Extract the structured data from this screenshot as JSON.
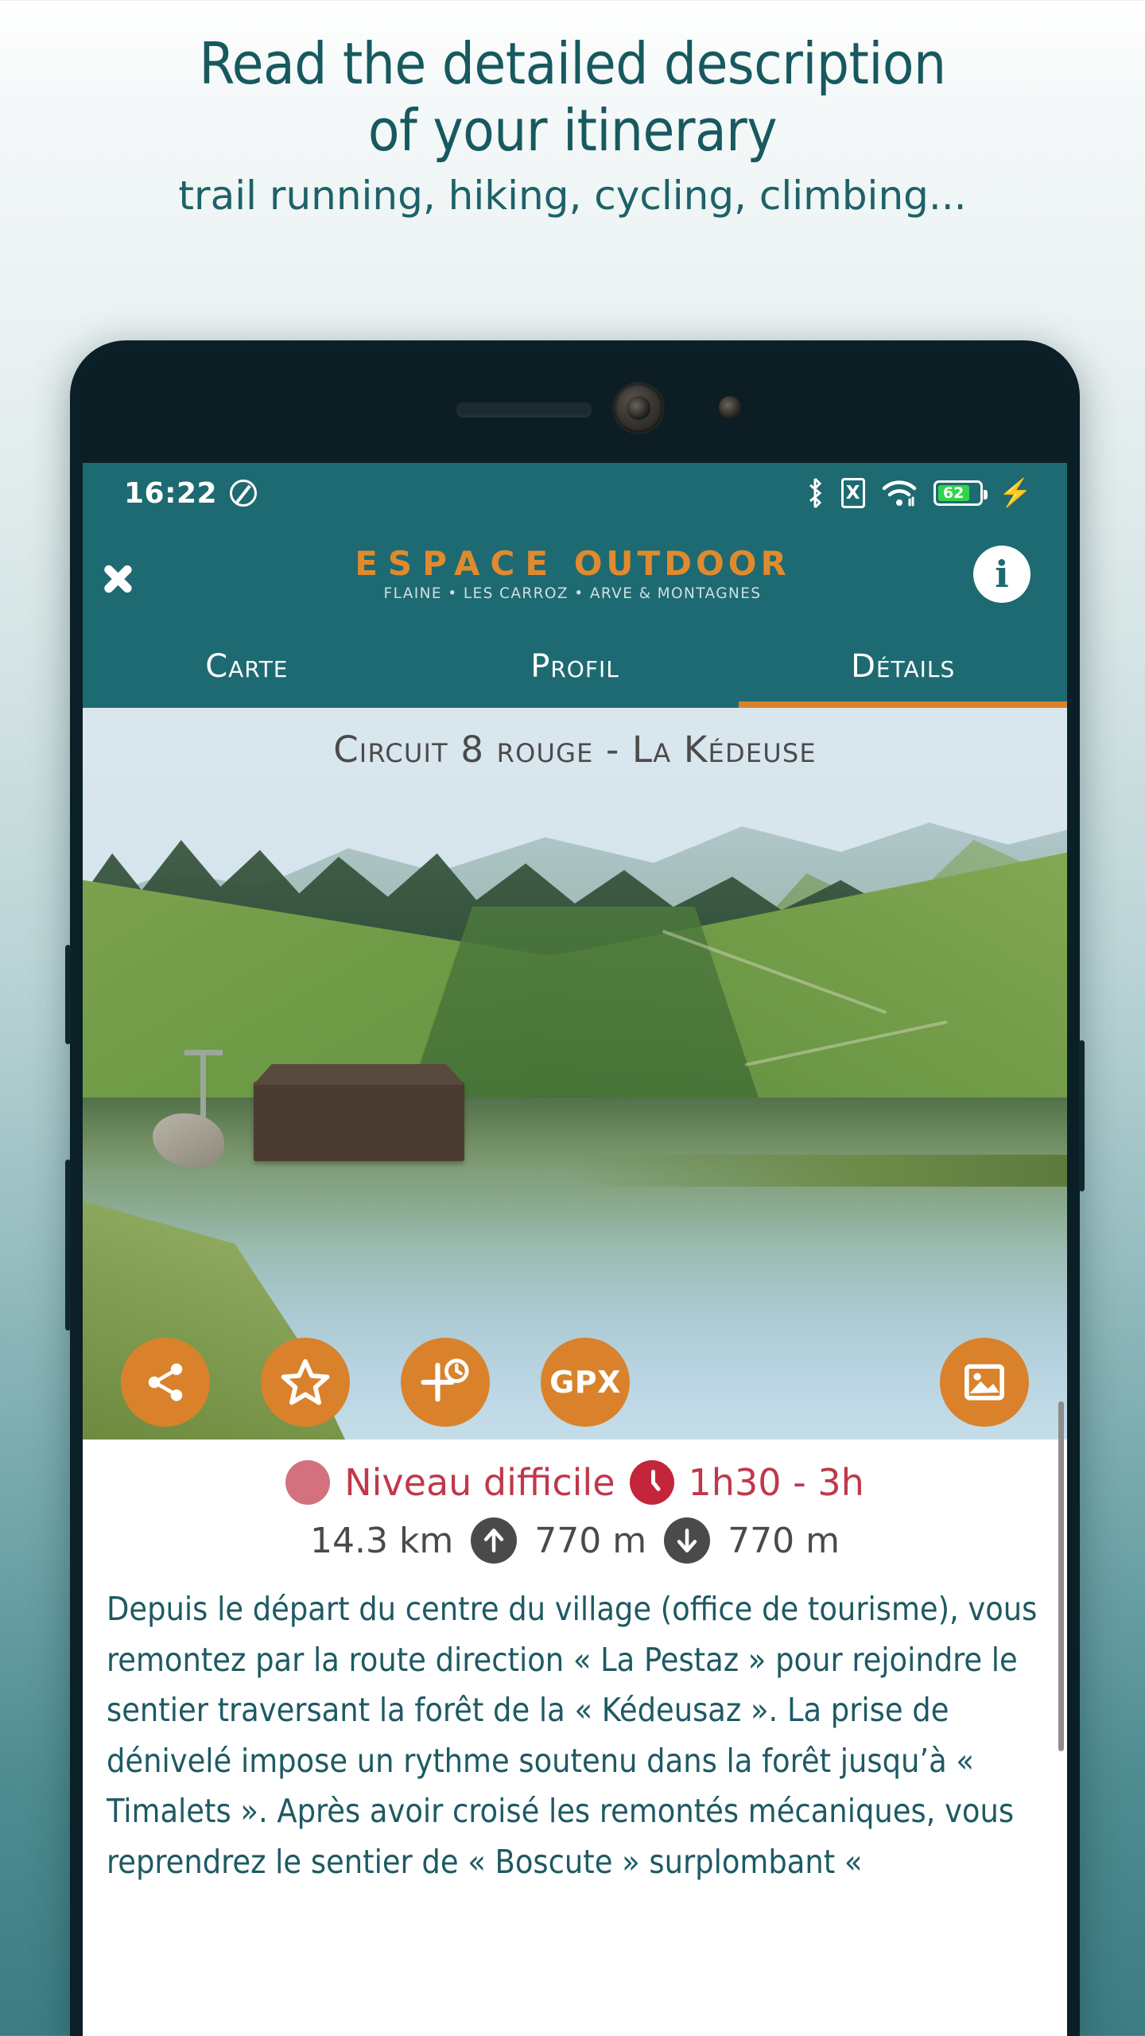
{
  "promo": {
    "headline_line1": "Read the detailed description",
    "headline_line2": "of your itinerary",
    "subheadline": "trail running, hiking, cycling, climbing..."
  },
  "statusbar": {
    "time": "16:22",
    "dnd_icon": "do-not-disturb-icon",
    "bluetooth_icon": "bluetooth-icon",
    "sim_label": "X",
    "wifi_icon": "wifi-icon",
    "battery_level": "62",
    "charging_icon": "charging-bolt-icon"
  },
  "appbar": {
    "back_icon": "back-chevron-icon",
    "logo_main_1": "ESPAC",
    "logo_main_2": "E",
    "logo_main_3": "OUTDOOR",
    "logo_sub": "FLAINE • LES CARROZ • ARVE & MONTAGNES",
    "info_icon": "i",
    "accent_color": "#d9822b",
    "bar_color": "#1e6a72"
  },
  "tabs": [
    {
      "label": "Carte",
      "active": false
    },
    {
      "label": "Profil",
      "active": false
    },
    {
      "label": "Détails",
      "active": true
    }
  ],
  "hero": {
    "title": "Circuit 8 rouge - La Kédeuse",
    "actions": [
      {
        "name": "share-button",
        "icon": "share-icon",
        "label": ""
      },
      {
        "name": "favorite-button",
        "icon": "star-icon",
        "label": ""
      },
      {
        "name": "add-schedule-button",
        "icon": "plus-clock-icon",
        "label": ""
      },
      {
        "name": "gpx-button",
        "icon": "gpx-text-icon",
        "label": "GPX"
      },
      {
        "name": "gallery-button",
        "icon": "image-icon",
        "label": ""
      }
    ]
  },
  "details": {
    "difficulty": "Niveau difficile",
    "difficulty_color": "#c0384a",
    "difficulty_dot_color": "#d3717e",
    "duration": "1h30 - 3h",
    "distance": "14.3 km",
    "ascent": "770 m",
    "descent": "770 m",
    "description": "Depuis le départ du centre du village (office de tourisme), vous remontez par la route direction « La Pestaz » pour rejoindre le sentier traversant la forêt de la « Kédeusaz ». La prise de dénivelé impose un rythme soutenu dans la forêt jusqu’à « Timalets ». Après avoir croisé les remontés mécaniques, vous reprendrez le sentier de « Boscute » surplombant «"
  }
}
